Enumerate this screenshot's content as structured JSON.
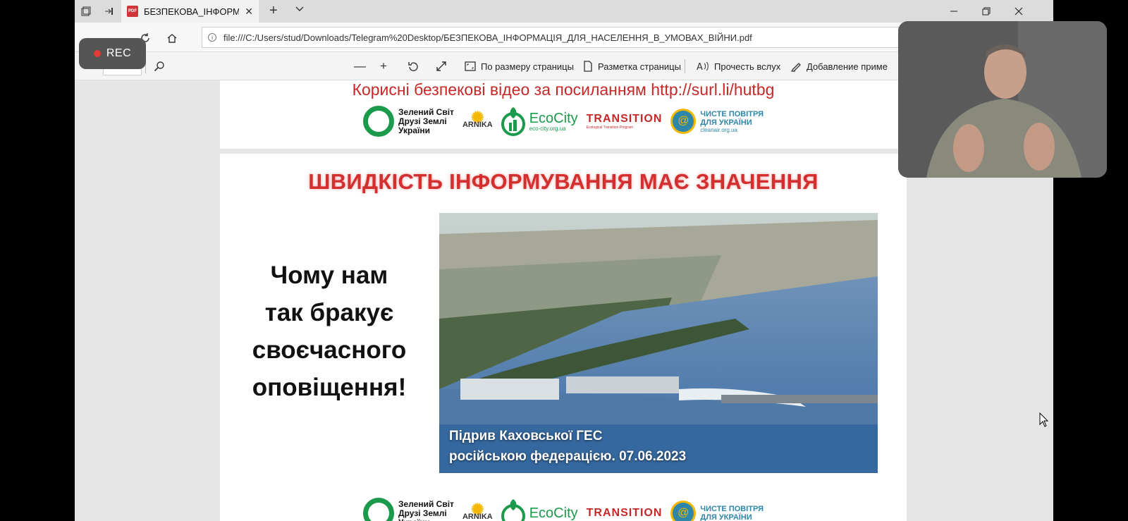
{
  "recording": {
    "label": "REC"
  },
  "browser": {
    "tab_title": "БЕЗПЕКОВА_ІНФОРМА",
    "url": "file:///C:/Users/stud/Downloads/Telegram%20Desktop/БЕЗПЕКОВА_ІНФОРМАЦІЯ_ДЛЯ_НАСЕЛЕННЯ_В_УМОВАХ_ВІЙНИ.pdf"
  },
  "pdf_toolbar": {
    "fit_page": "По размеру страницы",
    "page_layout": "Разметка страницы",
    "read_aloud": "Прочесть вслух",
    "add_notes": "Добавление приме"
  },
  "page1": {
    "link_text": "Корисні безпекові відео за посиланням http://surl.li/hutbg"
  },
  "logos": {
    "zs": "Зелений Світ\nДрузі Землі\nУкраїни",
    "arnika": "ARNIKA",
    "ecocity": "EcoCity",
    "ecocity_sub": "eco-city.org.ua",
    "transition": "TRANSITION",
    "transition_sub": "Ecological Transition Program",
    "air_line1": "ЧИСТЕ ПОВІТРЯ",
    "air_line2": "ДЛЯ УКРАЇНИ",
    "air_sub": "cleanair.org.ua"
  },
  "page2": {
    "heading": "ШВИДКІСТЬ ІНФОРМУВАННЯ МАЄ ЗНАЧЕННЯ",
    "why_line1": "Чому нам",
    "why_line2": "так бракує",
    "why_line3": "своєчасного",
    "why_line4": "оповіщення!",
    "caption_line1": "Підрив Каховської ГЕС",
    "caption_line2": "російською федерацією. 07.06.2023"
  },
  "colors": {
    "heading_red": "#d32f2f",
    "link_red": "#c62828",
    "eco_green": "#1a9a4a",
    "air_blue": "#2e86a8"
  }
}
